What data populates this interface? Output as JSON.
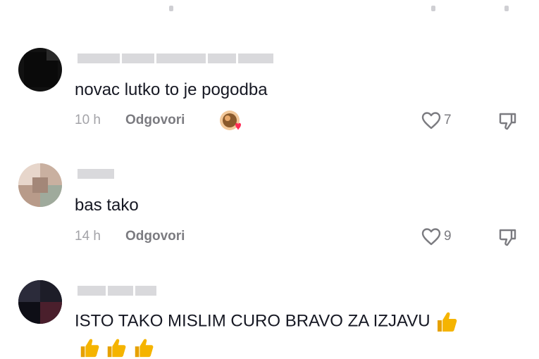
{
  "comments": [
    {
      "text": "novac lutko to je pogodba",
      "time": "10 h",
      "reply_label": "Odgovori",
      "likes": "7",
      "creator_liked": true
    },
    {
      "text": "bas tako",
      "time": "14 h",
      "reply_label": "Odgovori",
      "likes": "9",
      "creator_liked": false
    },
    {
      "text": "ISTO TAKO MISLIM CURO BRAVO ZA IZJAVU",
      "trailing_emoji": "thumbs-up-icon",
      "extra_emojis": [
        "thumbs-up-icon",
        "thumbs-up-icon",
        "thumbs-up-icon"
      ]
    }
  ],
  "colors": {
    "text": "#161823",
    "meta": "#7b7b80",
    "time": "#a3a3a8",
    "heart": "#fe2c55",
    "thumb": "#f5b400"
  }
}
